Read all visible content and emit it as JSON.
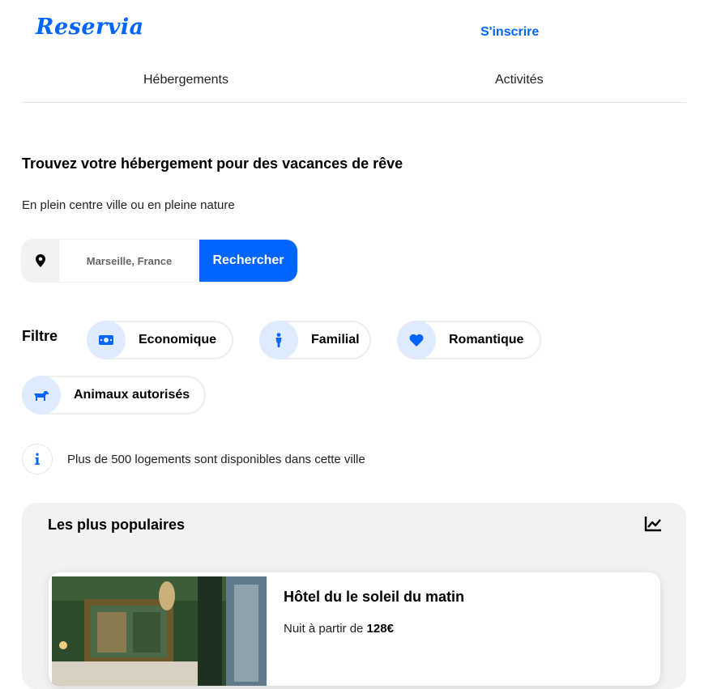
{
  "header": {
    "logo": "Reservia",
    "signup_label": "S'inscrire",
    "nav": [
      {
        "label": "Hébergements"
      },
      {
        "label": "Activités"
      }
    ]
  },
  "hero": {
    "headline": "Trouvez votre hébergement pour des vacances de rêve",
    "subtitle": "En plein centre ville ou en pleine nature",
    "search": {
      "icon": "location-pin-icon",
      "placeholder": "Marseille, France",
      "value": "",
      "button_label": "Rechercher"
    }
  },
  "filters": {
    "label": "Filtre",
    "items": [
      {
        "label": "Economique",
        "icon": "money-icon"
      },
      {
        "label": "Familial",
        "icon": "person-icon"
      },
      {
        "label": "Romantique",
        "icon": "heart-icon"
      },
      {
        "label": "Animaux autorisés",
        "icon": "dog-icon"
      }
    ]
  },
  "info": {
    "icon": "info-icon",
    "text": "Plus de 500 logements sont disponibles dans cette ville"
  },
  "popular": {
    "title": "Les plus populaires",
    "icon": "chart-line-icon",
    "cards": [
      {
        "name": "Hôtel du le soleil du matin",
        "price_prefix": "Nuit à partir de ",
        "price": "128€"
      }
    ]
  },
  "colors": {
    "accent": "#0065fc",
    "chip_icon_bg": "#deebff",
    "section_bg": "#f2f2f2"
  }
}
